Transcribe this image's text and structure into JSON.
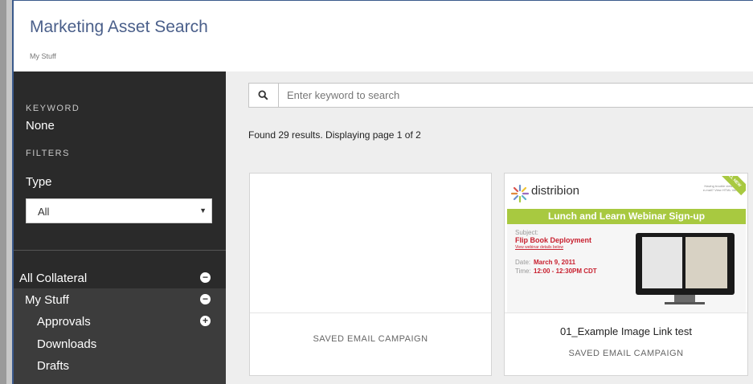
{
  "header": {
    "title": "Marketing Asset Search",
    "breadcrumb": "My Stuff"
  },
  "sidebar": {
    "keyword_label": "KEYWORD",
    "keyword_value": "None",
    "filters_label": "FILTERS",
    "type_label": "Type",
    "type_select_value": "All",
    "nav": [
      {
        "label": "All Collateral",
        "toggle": "−"
      },
      {
        "label": "My Stuff",
        "toggle": "−"
      },
      {
        "label": "Approvals",
        "toggle": "+"
      },
      {
        "label": "Downloads"
      },
      {
        "label": "Drafts"
      }
    ]
  },
  "search": {
    "placeholder": "Enter keyword to search"
  },
  "results_text": "Found 29 results. Displaying page 1 of 2",
  "cards": [
    {
      "name": "",
      "type": "SAVED EMAIL CAMPAIGN"
    },
    {
      "name": "01_Example Image Link test",
      "type": "SAVED EMAIL CAMPAIGN",
      "thumbnail": {
        "logo": "distribion",
        "note": "Having trouble viewing this e-mail? View HTML Version",
        "banner": "Lunch and Learn Webinar Sign-up",
        "subject_label": "Subject:",
        "subject": "Flip Book Deployment",
        "details_link": "View webinar details below",
        "date_label": "Date:",
        "date": "March 9, 2011",
        "time_label": "Time:",
        "time": "12:00 - 12:30PM CDT",
        "ribbon": "ALL NEW"
      }
    }
  ],
  "colors": {
    "banner_green": "#a8c940",
    "sidebar_dark": "#2a2a2a",
    "title_blue": "#4a5f8a",
    "accent_red": "#c8202f"
  }
}
